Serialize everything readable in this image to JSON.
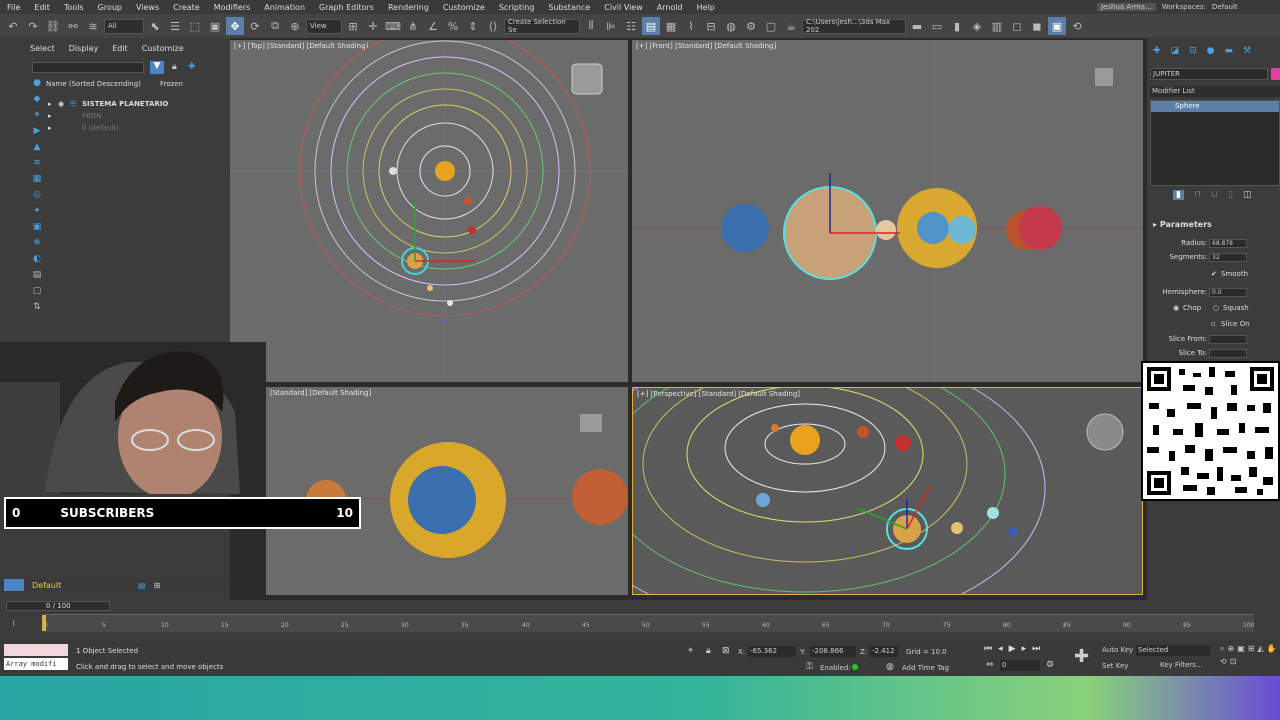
{
  "menu": [
    "File",
    "Edit",
    "Tools",
    "Group",
    "Views",
    "Create",
    "Modifiers",
    "Animation",
    "Graph Editors",
    "Rendering",
    "Customize",
    "Scripting",
    "Substance",
    "Civil View",
    "Arnold",
    "Help"
  ],
  "user": "Jeshua Arma...",
  "workspaces_label": "Workspaces:",
  "workspace_value": "Default",
  "toolbar": {
    "filter": "All",
    "view": "View",
    "selection_set": "Create Selection Se",
    "path": "C:\\Users\\jesh...\\3ds Max 202"
  },
  "scene_explorer": {
    "tabs": [
      "Select",
      "Display",
      "Edit",
      "Customize"
    ],
    "column_name": "Name (Sorted Descending)",
    "column_frozen": "Frozen",
    "rows": [
      "SISTEMA PLANETARIO",
      "PEON",
      "0 (default)"
    ],
    "layer": "Default"
  },
  "viewports": {
    "top": "[+] [Top] [Standard] [Default Shading]",
    "front": "[+] [Front] [Standard] [Default Shading]",
    "left": "[Standard] [Default Shading]",
    "perspective": "[+] [Perspective] [Standard] [Default Shading]"
  },
  "command_panel": {
    "object_name": "JUPITER",
    "modifier_list": "Modifier List",
    "stack_item": "Sphere",
    "rollout": "Parameters",
    "radius_label": "Radius:",
    "radius_value": "68.878",
    "segments_label": "Segments:",
    "segments_value": "32",
    "smooth": "Smooth",
    "hemisphere_label": "Hemisphere:",
    "hemisphere_value": "0.0",
    "chop": "Chop",
    "squash": "Squash",
    "slice_on": "Slice On",
    "slice_from": "Slice From:",
    "slice_to": "Slice To:"
  },
  "subscribers": {
    "left": "0",
    "label": "SUBSCRIBERS",
    "right": "10"
  },
  "timeline": {
    "frame": "0 / 100",
    "ticks": [
      "0",
      "5",
      "10",
      "15",
      "20",
      "25",
      "30",
      "35",
      "40",
      "45",
      "50",
      "55",
      "60",
      "65",
      "70",
      "75",
      "80",
      "85",
      "90",
      "95",
      "100"
    ]
  },
  "status": {
    "script_field": "Array modifi",
    "selected": "1 Object Selected",
    "hint": "Click and drag to select and move objects",
    "x_label": "X:",
    "x": "-65.362",
    "y_label": "Y:",
    "y": "-208.866",
    "z_label": "Z:",
    "z": "-2.412",
    "grid": "Grid = 10.0",
    "enabled": "Enabled:",
    "add_time_tag": "Add Time Tag",
    "auto_key": "Auto Key",
    "set_key": "Set Key",
    "key_mode": "Selected",
    "key_filters": "Key Filters...",
    "frame_field": "0"
  }
}
